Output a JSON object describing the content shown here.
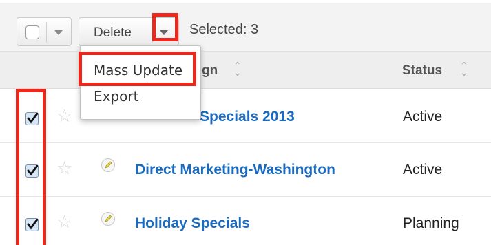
{
  "toolbar": {
    "delete_label": "Delete",
    "selected_text": "Selected: 3"
  },
  "table": {
    "columns": [
      {
        "label": "gn"
      },
      {
        "label": "Status"
      }
    ],
    "rows": [
      {
        "name": "Specials 2013",
        "status": "Active",
        "checked": true
      },
      {
        "name": "Direct Marketing-Washington",
        "status": "Active",
        "checked": true
      },
      {
        "name": "Holiday Specials",
        "status": "Planning",
        "checked": true
      }
    ]
  },
  "dropdown": {
    "items": [
      {
        "label": "Mass Update"
      },
      {
        "label": "Export"
      }
    ]
  },
  "colors": {
    "highlight": "#e8291c",
    "link": "#1a6bc0",
    "toolbar_bg": "#f3f3f3",
    "header_bg": "#eeeeee"
  },
  "icons": [
    "caret-down-icon",
    "sort-icon",
    "star-icon",
    "pencil-icon",
    "checkmark-icon"
  ]
}
